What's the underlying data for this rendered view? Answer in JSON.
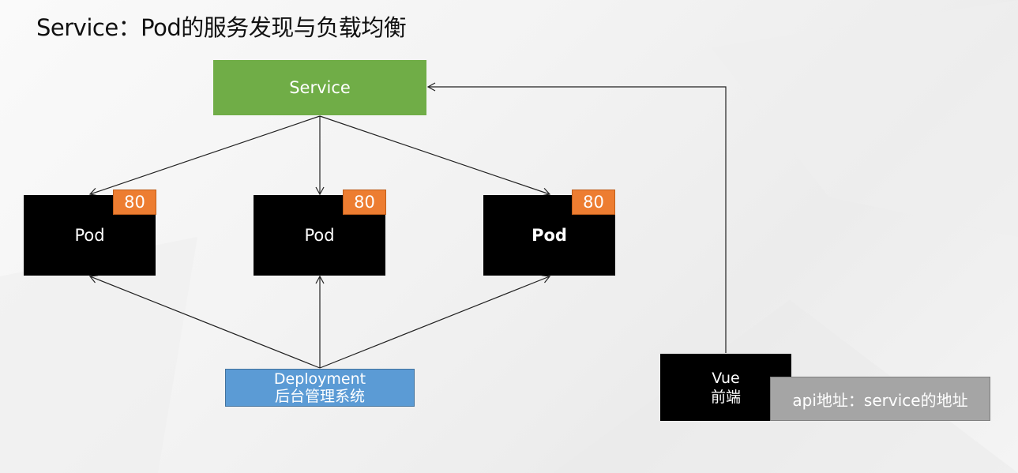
{
  "title": "Service：Pod的服务发现与负载均衡",
  "service": {
    "label": "Service",
    "color": "#70ad47"
  },
  "pods": [
    {
      "label": "Pod",
      "port": "80"
    },
    {
      "label": "Pod",
      "port": "80"
    },
    {
      "label": "Pod",
      "port": "80"
    }
  ],
  "deployment": {
    "line1": "Deployment",
    "line2": "后台管理系统",
    "color": "#5b9bd5"
  },
  "frontend": {
    "line1": "Vue",
    "line2": "前端"
  },
  "note": {
    "label": "api地址：service的地址",
    "color": "#a5a5a5"
  },
  "colors": {
    "pod": "#000000",
    "port": "#ed7d31"
  }
}
